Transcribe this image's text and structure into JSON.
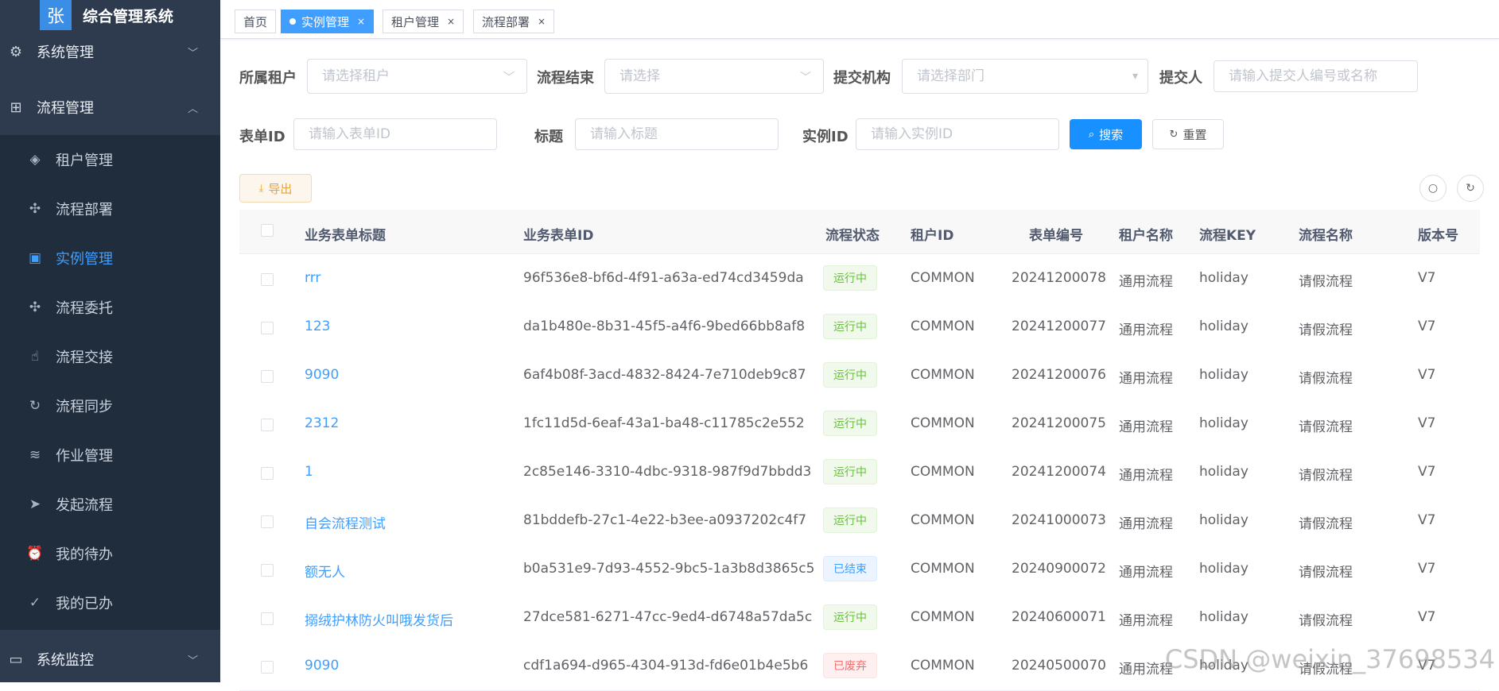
{
  "app": {
    "logo_char": "张",
    "title": "综合管理系统"
  },
  "sidebar": {
    "top_items": [
      {
        "label": "系统管理",
        "icon": "gear-icon"
      },
      {
        "label": "流程管理",
        "icon": "flow-icon"
      },
      {
        "label": "系统监控",
        "icon": "monitor-icon"
      }
    ],
    "sub_items": [
      {
        "label": "租户管理",
        "icon": "layers-icon"
      },
      {
        "label": "流程部署",
        "icon": "deploy-icon"
      },
      {
        "label": "实例管理",
        "icon": "chart-icon",
        "active": true
      },
      {
        "label": "流程委托",
        "icon": "delegate-icon"
      },
      {
        "label": "流程交接",
        "icon": "hand-icon"
      },
      {
        "label": "流程同步",
        "icon": "sync-icon"
      },
      {
        "label": "作业管理",
        "icon": "job-icon"
      },
      {
        "label": "发起流程",
        "icon": "send-icon"
      },
      {
        "label": "我的待办",
        "icon": "alarm-icon"
      },
      {
        "label": "我的已办",
        "icon": "check-circle-icon"
      }
    ]
  },
  "tabs": [
    {
      "label": "首页"
    },
    {
      "label": "实例管理",
      "active": true
    },
    {
      "label": "租户管理"
    },
    {
      "label": "流程部署"
    }
  ],
  "filters": {
    "tenant": {
      "label": "所属租户",
      "placeholder": "请选择租户"
    },
    "flow_end": {
      "label": "流程结束",
      "placeholder": "请选择"
    },
    "org": {
      "label": "提交机构",
      "placeholder": "请选择部门"
    },
    "submitter": {
      "label": "提交人",
      "placeholder": "请输入提交人编号或名称"
    },
    "form_id": {
      "label": "表单ID",
      "placeholder": "请输入表单ID"
    },
    "title": {
      "label": "标题",
      "placeholder": "请输入标题"
    },
    "instance_id": {
      "label": "实例ID",
      "placeholder": "请输入实例ID"
    },
    "search_label": "搜索",
    "reset_label": "重置"
  },
  "toolbar": {
    "export_label": "导出"
  },
  "table": {
    "columns": [
      "业务表单标题",
      "业务表单ID",
      "流程状态",
      "租户ID",
      "表单编号",
      "租户名称",
      "流程KEY",
      "流程名称",
      "版本号"
    ],
    "rows": [
      {
        "title": "rrr",
        "form_id": "96f536e8-bf6d-4f91-a63a-ed74cd3459da",
        "status": "运行中",
        "status_color": "green",
        "tenant_id": "COMMON",
        "form_no": "20241200078",
        "tenant_name": "通用流程",
        "key": "holiday",
        "flow_name": "请假流程",
        "version": "V7"
      },
      {
        "title": "123",
        "form_id": "da1b480e-8b31-45f5-a4f6-9bed66bb8af8",
        "status": "运行中",
        "status_color": "green",
        "tenant_id": "COMMON",
        "form_no": "20241200077",
        "tenant_name": "通用流程",
        "key": "holiday",
        "flow_name": "请假流程",
        "version": "V7"
      },
      {
        "title": "9090",
        "form_id": "6af4b08f-3acd-4832-8424-7e710deb9c87",
        "status": "运行中",
        "status_color": "green",
        "tenant_id": "COMMON",
        "form_no": "20241200076",
        "tenant_name": "通用流程",
        "key": "holiday",
        "flow_name": "请假流程",
        "version": "V7"
      },
      {
        "title": "2312",
        "form_id": "1fc11d5d-6eaf-43a1-ba48-c11785c2e552",
        "status": "运行中",
        "status_color": "green",
        "tenant_id": "COMMON",
        "form_no": "20241200075",
        "tenant_name": "通用流程",
        "key": "holiday",
        "flow_name": "请假流程",
        "version": "V7"
      },
      {
        "title": "1",
        "form_id": "2c85e146-3310-4dbc-9318-987f9d7bbdd3",
        "status": "运行中",
        "status_color": "green",
        "tenant_id": "COMMON",
        "form_no": "20241200074",
        "tenant_name": "通用流程",
        "key": "holiday",
        "flow_name": "请假流程",
        "version": "V7"
      },
      {
        "title": "自会流程测试",
        "form_id": "81bddefb-27c1-4e22-b3ee-a0937202c4f7",
        "status": "运行中",
        "status_color": "green",
        "tenant_id": "COMMON",
        "form_no": "20241000073",
        "tenant_name": "通用流程",
        "key": "holiday",
        "flow_name": "请假流程",
        "version": "V7"
      },
      {
        "title": "额无人",
        "form_id": "b0a531e9-7d93-4552-9bc5-1a3b8d3865c5",
        "status": "已结束",
        "status_color": "blue",
        "tenant_id": "COMMON",
        "form_no": "20240900072",
        "tenant_name": "通用流程",
        "key": "holiday",
        "flow_name": "请假流程",
        "version": "V7"
      },
      {
        "title": "搦绒护林防火叫哦发货后",
        "form_id": "27dce581-6271-47cc-9ed4-d6748a57da5c",
        "status": "运行中",
        "status_color": "green",
        "tenant_id": "COMMON",
        "form_no": "20240600071",
        "tenant_name": "通用流程",
        "key": "holiday",
        "flow_name": "请假流程",
        "version": "V7"
      },
      {
        "title": "9090",
        "form_id": "cdf1a694-d965-4304-913d-fd6e01b4e5b6",
        "status": "已废弃",
        "status_color": "red",
        "tenant_id": "COMMON",
        "form_no": "20240500070",
        "tenant_name": "通用流程",
        "key": "holiday",
        "flow_name": "请假流程",
        "version": "V7"
      }
    ]
  },
  "watermark": "CSDN @weixin_37698534"
}
